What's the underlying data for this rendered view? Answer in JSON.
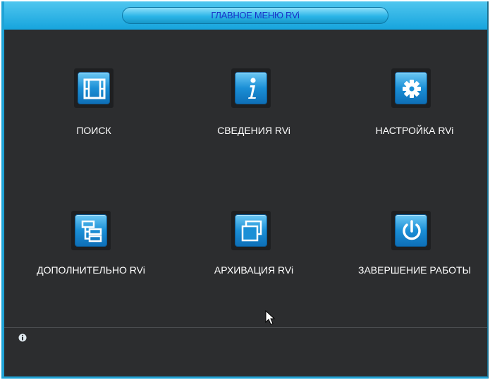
{
  "window": {
    "title": "ГЛАВНОЕ МЕНЮ  RVi"
  },
  "menu": {
    "items": [
      {
        "label": "ПОИСК",
        "icon": "film-icon"
      },
      {
        "label": "СВЕДЕНИЯ  RVi",
        "icon": "info-icon"
      },
      {
        "label": "НАСТРОЙКА  RVi",
        "icon": "gear-icon"
      },
      {
        "label": "ДОПОЛНИТЕЛЬНО  RVi",
        "icon": "tree-icon"
      },
      {
        "label": "АРХИВАЦИЯ  RVi",
        "icon": "windows-icon"
      },
      {
        "label": "ЗАВЕРШЕНИЕ РАБОТЫ",
        "icon": "power-icon"
      }
    ]
  },
  "status_bar": {
    "icon": "info-icon",
    "message": ""
  },
  "colors": {
    "accent": "#1fa3d6",
    "background": "#2c2d2f",
    "title_text": "#1a32c8",
    "label_text": "#ffffff"
  }
}
